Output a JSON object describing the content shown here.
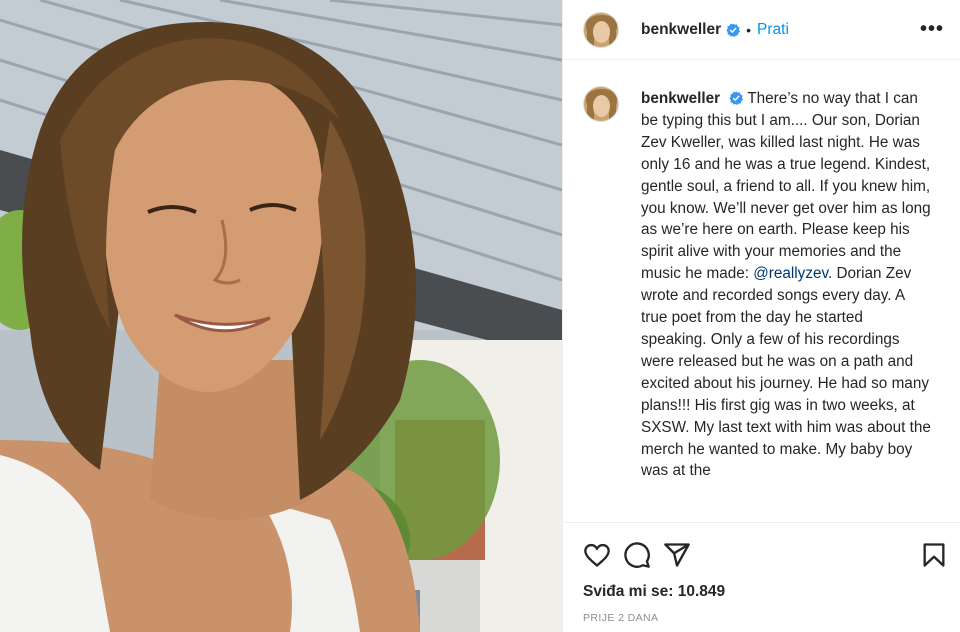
{
  "post": {
    "photo_icon": "portrait-photo",
    "header": {
      "username": "benkweller",
      "verified_icon": "verified-badge-icon",
      "separator": "•",
      "follow_label": "Prati",
      "more_icon": "more-options-icon",
      "more_label": "•••"
    },
    "caption": {
      "username": "benkweller",
      "text_before_mention": "There’s no way that I can be typing this but I am.... Our son, Dorian Zev Kweller, was killed last night. He was only 16 and he was a true legend. Kindest, gentle soul, a friend to all. If you knew him, you know. We’ll never get over him as long as we’re here on earth. Please keep his spirit alive with your memories and the music he made:",
      "mention": "@reallyzev",
      "text_after_mention": ". Dorian Zev wrote and recorded songs every day. A true poet from the day he started speaking. Only a few of his recordings were released but he was on a path and excited about his journey. He had so many plans!!! His first gig was in two weeks, at SXSW. My last text with him was about the merch he wanted to make. My baby boy was at the"
    },
    "actions": {
      "like_icon": "heart-icon",
      "comment_icon": "comment-icon",
      "share_icon": "share-icon",
      "save_icon": "bookmark-icon"
    },
    "likes_text": "Sviđa mi se: 10.849",
    "timestamp": "PRIJE 2 DANA",
    "colors": {
      "link_blue": "#0095f6",
      "mention_blue": "#00376b",
      "text": "#262626",
      "muted": "#8e8e8e"
    }
  }
}
